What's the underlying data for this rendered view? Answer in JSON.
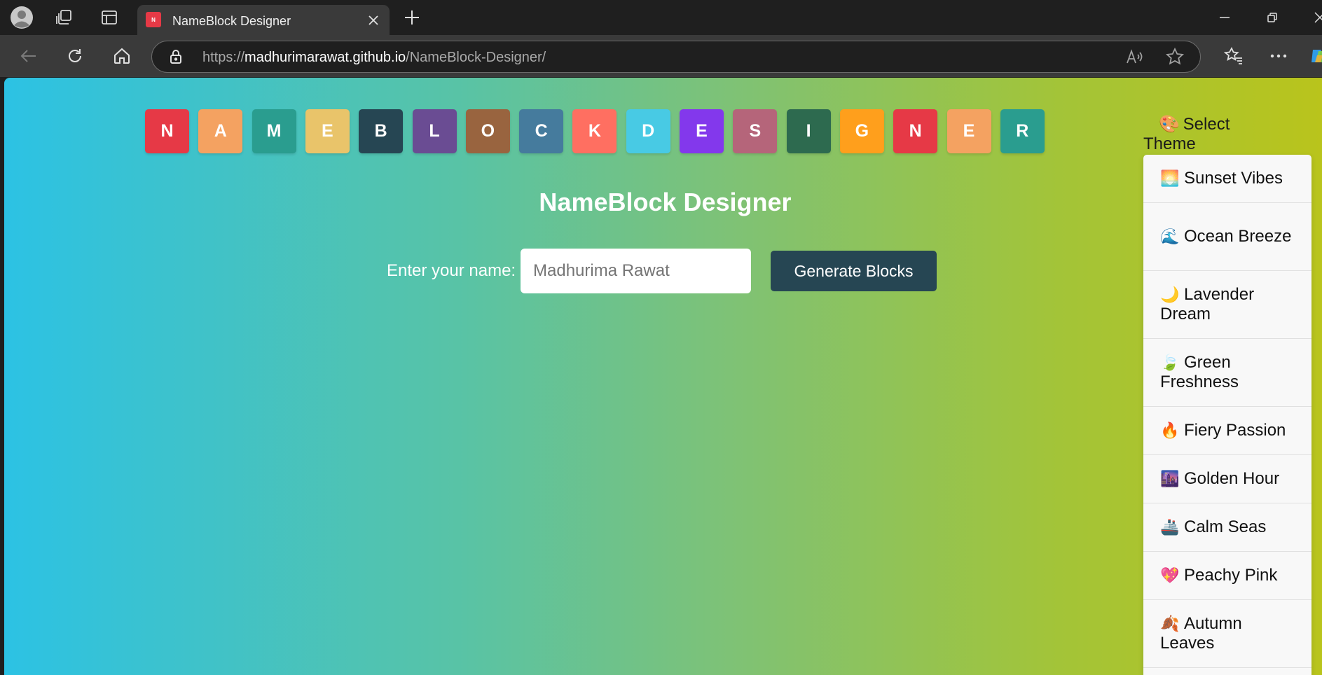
{
  "browser": {
    "tab_title": "NameBlock Designer",
    "tab_favicon_text": "N",
    "url_scheme": "https://",
    "url_host": "madhurimarawat.github.io",
    "url_path": "/NameBlock-Designer/"
  },
  "page": {
    "title": "NameBlock Designer",
    "letters": [
      {
        "char": "N",
        "color": "#e63946"
      },
      {
        "char": "A",
        "color": "#f4a261"
      },
      {
        "char": "M",
        "color": "#2a9d8f"
      },
      {
        "char": "E",
        "color": "#e9c46a"
      },
      {
        "char": "B",
        "color": "#264653"
      },
      {
        "char": "L",
        "color": "#6a4c93"
      },
      {
        "char": "O",
        "color": "#99643f"
      },
      {
        "char": "C",
        "color": "#457b9d"
      },
      {
        "char": "K",
        "color": "#ff6f61"
      },
      {
        "char": "D",
        "color": "#48cae4"
      },
      {
        "char": "E",
        "color": "#8338ec"
      },
      {
        "char": "S",
        "color": "#b5657a"
      },
      {
        "char": "I",
        "color": "#2d6a4f"
      },
      {
        "char": "G",
        "color": "#ff9f1c"
      },
      {
        "char": "N",
        "color": "#e63946"
      },
      {
        "char": "E",
        "color": "#f4a261"
      },
      {
        "char": "R",
        "color": "#2a9d8f"
      }
    ],
    "form": {
      "label": "Enter your name:",
      "placeholder": "Madhurima Rawat",
      "value": "",
      "button_label": "Generate Blocks"
    },
    "theme": {
      "label_emoji": "🎨",
      "label": "Select Theme",
      "options": [
        {
          "emoji": "🌅",
          "label": "Sunset Vibes"
        },
        {
          "emoji": "🌊",
          "label": "Ocean Breeze"
        },
        {
          "emoji": "🌙",
          "label": "Lavender Dream"
        },
        {
          "emoji": "🍃",
          "label": "Green Freshness"
        },
        {
          "emoji": "🔥",
          "label": "Fiery Passion"
        },
        {
          "emoji": "🌆",
          "label": "Golden Hour"
        },
        {
          "emoji": "🚢",
          "label": "Calm Seas"
        },
        {
          "emoji": "💖",
          "label": "Peachy Pink"
        },
        {
          "emoji": "🍂",
          "label": "Autumn Leaves"
        }
      ]
    }
  }
}
